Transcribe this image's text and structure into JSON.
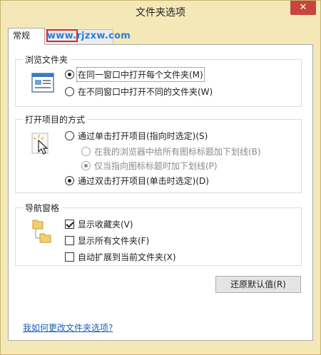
{
  "window": {
    "title": "文件夹选项",
    "close_glyph": "✕"
  },
  "tabs": [
    {
      "label": "常规",
      "selected": true
    },
    {
      "label": "",
      "selected": false
    }
  ],
  "watermark": {
    "text": "www.rjzxw.com"
  },
  "groups": {
    "browse": {
      "title": "浏览文件夹",
      "icon": "window-icon",
      "options": [
        {
          "label": "在同一窗口中打开每个文件夹(M)",
          "checked": true,
          "disabled": false,
          "focused": true
        },
        {
          "label": "在不同窗口中打开不同的文件夹(W)",
          "checked": false,
          "disabled": false,
          "focused": false
        }
      ]
    },
    "click": {
      "title": "打开项目的方式",
      "icon": "cursor-click-icon",
      "options": [
        {
          "label": "通过单击打开项目(指向时选定)(S)",
          "checked": false,
          "disabled": false
        },
        {
          "label": "在我的浏览器中给所有图标标题加下划线(B)",
          "checked": false,
          "disabled": true
        },
        {
          "label": "仅当指向图标标题时加下划线(P)",
          "checked": true,
          "disabled": true
        },
        {
          "label": "通过双击打开项目(单击时选定)(D)",
          "checked": true,
          "disabled": false
        }
      ]
    },
    "nav": {
      "title": "导航窗格",
      "icon": "folder-tree-icon",
      "options": [
        {
          "label": "显示收藏夹(V)",
          "checked": true
        },
        {
          "label": "显示所有文件夹(F)",
          "checked": false
        },
        {
          "label": "自动扩展到当前文件夹(X)",
          "checked": false
        }
      ]
    }
  },
  "buttons": {
    "restore_defaults": "还原默认值(R)"
  },
  "help_link": "我如何更改文件夹选项?",
  "colors": {
    "frame": "#f4e8b8",
    "close": "#c7453c",
    "link": "#1b5fb9",
    "watermark": "#2a7fd8",
    "watermark_box": "#d62b2b"
  }
}
